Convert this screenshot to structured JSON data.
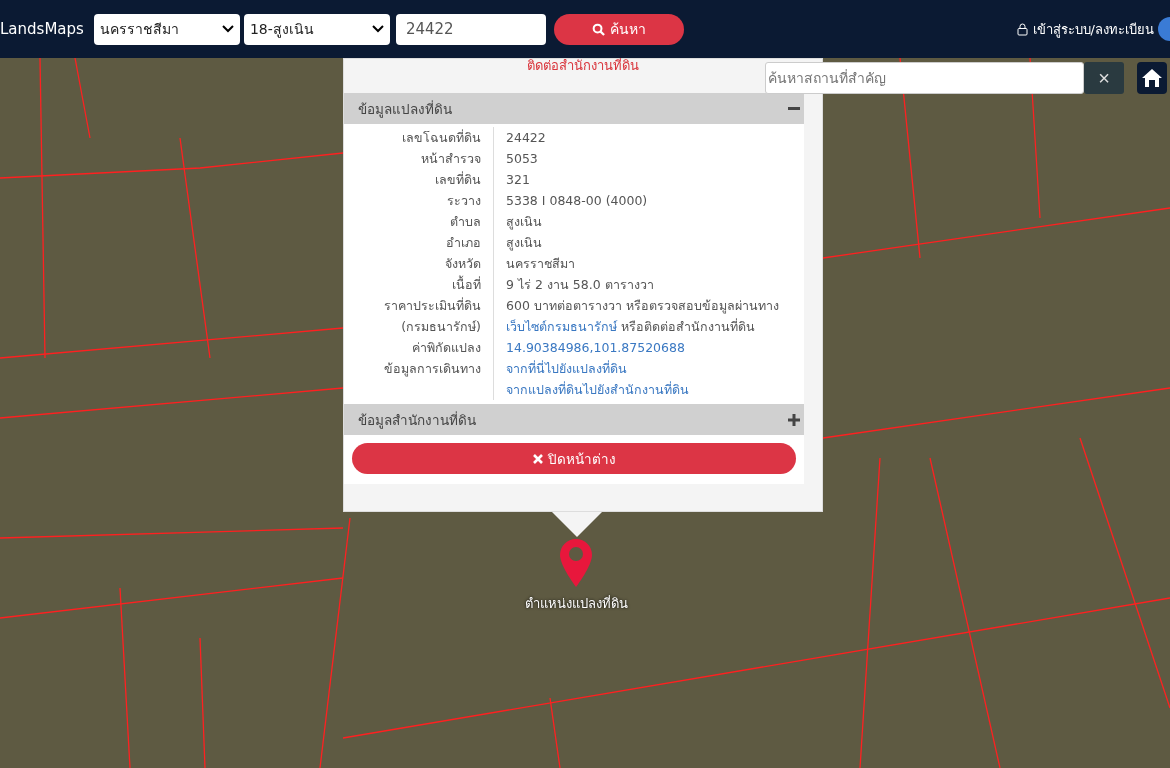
{
  "header": {
    "logo": "LandsMaps",
    "province": "นครราชสีมา",
    "district": "18-สูงเนิน",
    "parcel_number": "24422",
    "search_button": "ค้นหา",
    "login": "เข้าสู่ระบบ/ลงทะเบียน"
  },
  "place_search": {
    "placeholder": "ค้นหาสถานที่สำคัญ",
    "clear": "×"
  },
  "popup": {
    "contact_note": "ติดต่อสำนักงานที่ดิน",
    "sections": [
      {
        "title": "ข้อมูลแปลงที่ดิน",
        "expanded": true,
        "rows": [
          {
            "label": "เลขโฉนดที่ดิน",
            "lines": [
              [
                {
                  "text": "24422",
                  "link": false
                }
              ]
            ]
          },
          {
            "label": "หน้าสำรวจ",
            "lines": [
              [
                {
                  "text": "5053",
                  "link": false
                }
              ]
            ]
          },
          {
            "label": "เลขที่ดิน",
            "lines": [
              [
                {
                  "text": "321",
                  "link": false
                }
              ]
            ]
          },
          {
            "label": "ระวาง",
            "lines": [
              [
                {
                  "text": "5338 I 0848-00 (4000)",
                  "link": false
                }
              ]
            ]
          },
          {
            "label": "ตำบล",
            "lines": [
              [
                {
                  "text": "สูงเนิน",
                  "link": false
                }
              ]
            ]
          },
          {
            "label": "อำเภอ",
            "lines": [
              [
                {
                  "text": "สูงเนิน",
                  "link": false
                }
              ]
            ]
          },
          {
            "label": "จังหวัด",
            "lines": [
              [
                {
                  "text": "นครราชสีมา",
                  "link": false
                }
              ]
            ]
          },
          {
            "label": "เนื้อที่",
            "lines": [
              [
                {
                  "text": "9 ไร่ 2 งาน 58.0 ตารางวา",
                  "link": false
                }
              ]
            ]
          },
          {
            "label": "ราคาประเมินที่ดิน",
            "lines": [
              [
                {
                  "text": "600 บาทต่อตารางวา หรือตรวจสอบข้อมูลผ่านทาง",
                  "link": false
                }
              ]
            ]
          },
          {
            "label": "(กรมธนารักษ์)",
            "lines": [
              [
                {
                  "text": "เว็บไซต์กรมธนารักษ์",
                  "link": true
                },
                {
                  "text": " หรือติดต่อสำนักงานที่ดิน",
                  "link": false
                }
              ]
            ]
          },
          {
            "label": "ค่าพิกัดแปลง",
            "lines": [
              [
                {
                  "text": "14.90384986,101.87520688",
                  "link": true
                }
              ]
            ]
          },
          {
            "label": "ข้อมูลการเดินทาง",
            "lines": [
              [
                {
                  "text": "จากที่นี่ไปยังแปลงที่ดิน",
                  "link": true
                }
              ],
              [
                {
                  "text": "จากแปลงที่ดินไปยังสำนักงานที่ดิน",
                  "link": true
                }
              ]
            ]
          }
        ]
      },
      {
        "title": "ข้อมูลสำนักงานที่ดิน",
        "expanded": false
      }
    ],
    "close_button": "ปิดหน้าต่าง"
  },
  "marker": {
    "label": "ตำแหน่งแปลงที่ดิน"
  }
}
